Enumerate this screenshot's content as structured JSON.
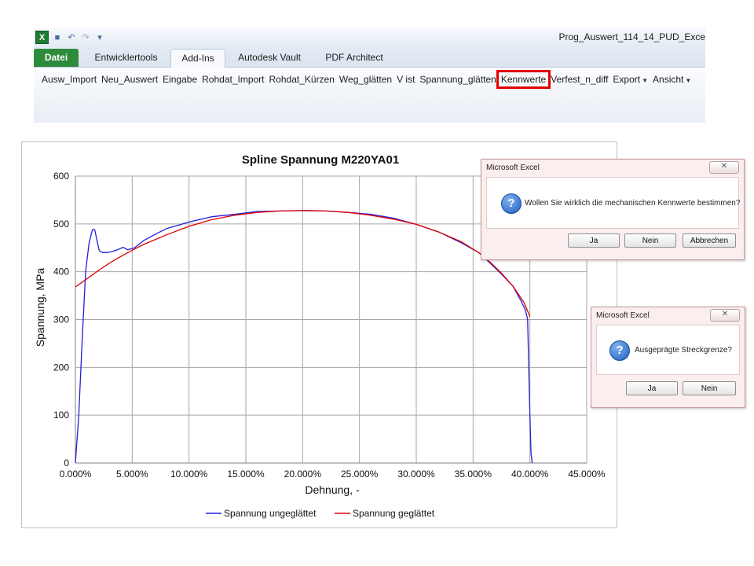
{
  "window": {
    "document_title": "Prog_Auswert_114_14_PUD_Exce",
    "qat_icons": [
      "excel-icon",
      "save-icon",
      "undo-icon",
      "redo-icon",
      "customize-qat-icon"
    ]
  },
  "ribbon": {
    "tabs": [
      {
        "label": "Datei"
      },
      {
        "label": "Entwicklertools"
      },
      {
        "label": "Add-Ins"
      },
      {
        "label": "Autodesk Vault"
      },
      {
        "label": "PDF Architect"
      }
    ],
    "active_tab": "Add-Ins",
    "menu_items": [
      {
        "label": "Ausw_Import"
      },
      {
        "label": "Neu_Auswert"
      },
      {
        "label": "Eingabe"
      },
      {
        "label": "Rohdat_Import"
      },
      {
        "label": "Rohdat_Kürzen"
      },
      {
        "label": "Weg_glätten"
      },
      {
        "label": "V ist"
      },
      {
        "label": "Spannung_glätten"
      },
      {
        "label": "Kennwerte"
      },
      {
        "label": "Verfest_n_diff"
      },
      {
        "label": "Export"
      },
      {
        "label": "Ansicht"
      }
    ],
    "highlighted_item": "Kennwerte",
    "highlight_color": "#e00000"
  },
  "chart_data": {
    "type": "line",
    "title": "Spline Spannung M220YA01",
    "xlabel": "Dehnung, -",
    "ylabel": "Spannung, MPa",
    "xlim": [
      0,
      0.45
    ],
    "ylim": [
      0,
      600
    ],
    "x_ticks": [
      "0.000%",
      "5.000%",
      "10.000%",
      "15.000%",
      "20.000%",
      "25.000%",
      "30.000%",
      "35.000%",
      "40.000%",
      "45.000%"
    ],
    "y_ticks": [
      "0",
      "100",
      "200",
      "300",
      "400",
      "500",
      "600"
    ],
    "grid": true,
    "legend_position": "bottom",
    "series": [
      {
        "name": "Spannung ungeglättet",
        "color": "#1f1fdb",
        "x": [
          0.0,
          0.003,
          0.006,
          0.009,
          0.012,
          0.015,
          0.017,
          0.019,
          0.021,
          0.024,
          0.028,
          0.032,
          0.036,
          0.042,
          0.046,
          0.052,
          0.06,
          0.07,
          0.08,
          0.09,
          0.1,
          0.12,
          0.14,
          0.16,
          0.18,
          0.2,
          0.22,
          0.24,
          0.26,
          0.28,
          0.3,
          0.32,
          0.34,
          0.355,
          0.365,
          0.375,
          0.385,
          0.392,
          0.396,
          0.398,
          0.399,
          0.4,
          0.401,
          0.402
        ],
        "values": [
          0,
          100,
          260,
          400,
          460,
          488,
          488,
          465,
          444,
          440,
          440,
          442,
          445,
          451,
          446,
          450,
          465,
          478,
          490,
          497,
          504,
          515,
          520,
          526,
          527,
          528,
          527,
          524,
          520,
          512,
          499,
          483,
          460,
          440,
          418,
          395,
          370,
          340,
          320,
          300,
          200,
          100,
          20,
          0
        ]
      },
      {
        "name": "Spannung geglättet",
        "color": "#e00000",
        "x": [
          0.0,
          0.01,
          0.02,
          0.03,
          0.04,
          0.05,
          0.06,
          0.08,
          0.1,
          0.12,
          0.14,
          0.16,
          0.18,
          0.2,
          0.22,
          0.24,
          0.26,
          0.28,
          0.3,
          0.32,
          0.34,
          0.355,
          0.365,
          0.375,
          0.385,
          0.395,
          0.4
        ],
        "values": [
          368,
          385,
          402,
          418,
          432,
          445,
          457,
          477,
          495,
          509,
          518,
          524,
          527,
          528,
          527,
          524,
          518,
          510,
          499,
          483,
          462,
          440,
          420,
          397,
          370,
          335,
          306
        ]
      }
    ]
  },
  "dialog1": {
    "title": "Microsoft Excel",
    "message": "Wollen Sie wirklich die mechanischen Kennwerte bestimmen?",
    "buttons": [
      {
        "label": "Ja"
      },
      {
        "label": "Nein"
      },
      {
        "label": "Abbrechen"
      }
    ],
    "icon": "question-icon"
  },
  "dialog2": {
    "title": "Microsoft Excel",
    "message": "Ausgeprägte Streckgrenze?",
    "buttons": [
      {
        "label": "Ja"
      },
      {
        "label": "Nein"
      }
    ],
    "icon": "question-icon"
  }
}
